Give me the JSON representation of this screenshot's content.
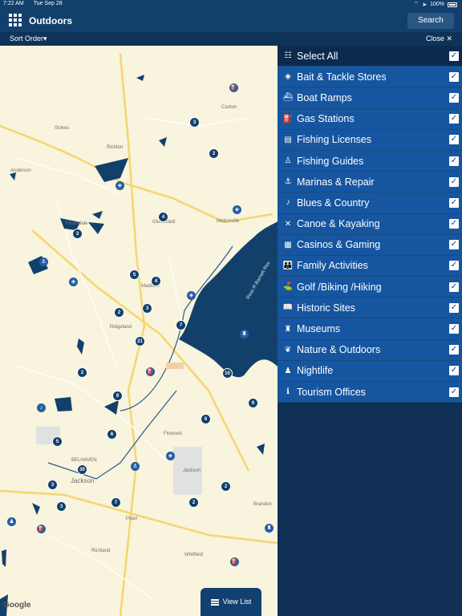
{
  "status": {
    "time": "7:22 AM",
    "date": "Tue Sep 28",
    "battery": "100%",
    "wifi": "wifi-icon",
    "location": "location-arrow-icon"
  },
  "header": {
    "title": "Outdoors",
    "search_label": "Search"
  },
  "subbar": {
    "sort_label": "Sort Order▾",
    "close_label": "Close ✕"
  },
  "map": {
    "labels": [
      "Stokes",
      "Richton",
      "Canton",
      "Anderson",
      "Flindsdale",
      "Gluckstadt",
      "Meltonville",
      "Madison",
      "Ridgeland",
      "Ross R Barnett Res",
      "Flowood",
      "BELHAVEN",
      "Jackson",
      "Pearl",
      "Richland",
      "Whitfield",
      "Brandon",
      "Jackson"
    ],
    "clusters": [
      "3",
      "2",
      "4",
      "3",
      "5",
      "4",
      "2",
      "3",
      "7",
      "21",
      "2",
      "9",
      "6",
      "5",
      "6",
      "30",
      "3",
      "3",
      "7",
      "2",
      "2",
      "10",
      "6"
    ],
    "google": "Google",
    "view_list": "View List"
  },
  "panel": {
    "select_all": "Select All",
    "items": [
      {
        "label": "Bait & Tackle Stores",
        "icon": "bait-icon"
      },
      {
        "label": "Boat Ramps",
        "icon": "boat-ramp-icon"
      },
      {
        "label": "Gas Stations",
        "icon": "gas-pump-icon"
      },
      {
        "label": "Fishing Licenses",
        "icon": "license-icon"
      },
      {
        "label": "Fishing Guides",
        "icon": "fishing-guide-icon"
      },
      {
        "label": "Marinas & Repair",
        "icon": "anchor-icon"
      },
      {
        "label": "Blues & Country",
        "icon": "music-note-icon"
      },
      {
        "label": "Canoe & Kayaking",
        "icon": "paddle-icon"
      },
      {
        "label": "Casinos & Gaming",
        "icon": "casino-icon"
      },
      {
        "label": "Family Activities",
        "icon": "family-icon"
      },
      {
        "label": "Golf /Biking /Hiking",
        "icon": "golf-icon"
      },
      {
        "label": "Historic Sites",
        "icon": "book-icon"
      },
      {
        "label": "Museums",
        "icon": "museum-icon"
      },
      {
        "label": "Nature & Outdoors",
        "icon": "nature-icon"
      },
      {
        "label": "Nightlife",
        "icon": "nightlife-icon"
      },
      {
        "label": "Tourism Offices",
        "icon": "info-icon"
      }
    ]
  }
}
